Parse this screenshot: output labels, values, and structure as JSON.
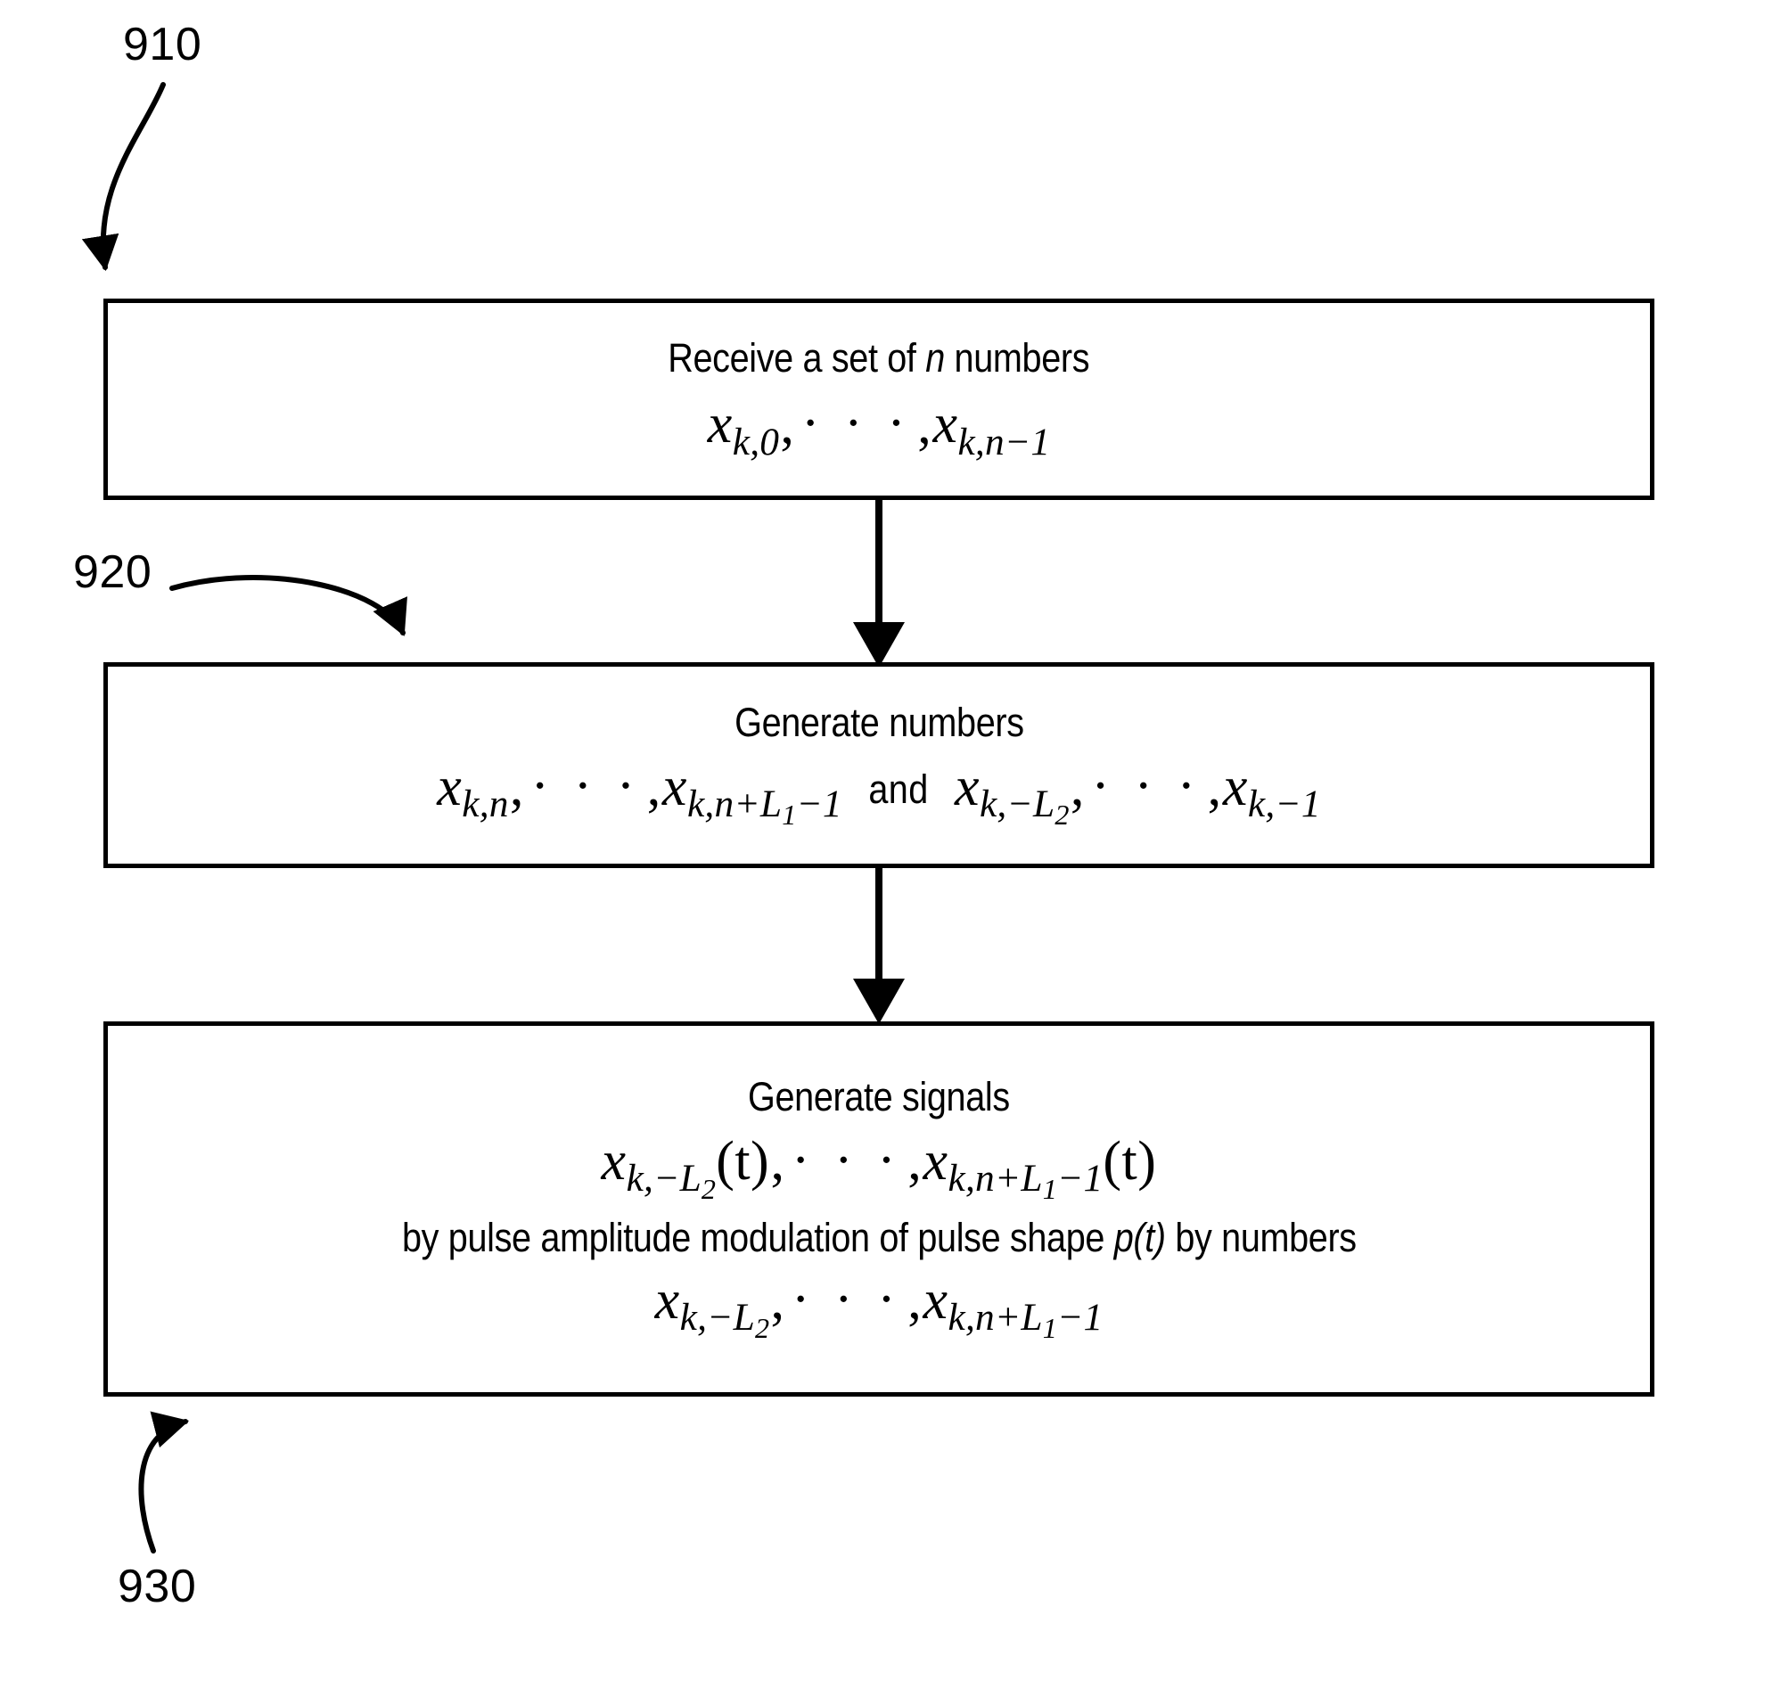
{
  "figure": {
    "type": "patent-flowchart",
    "orientation": "vertical-top-to-bottom",
    "background_color": "#ffffff",
    "line_color": "#000000",
    "step_count": 3
  },
  "reference_numerals": {
    "first": "910",
    "second": "920",
    "third": "930"
  },
  "steps": [
    {
      "numeral": "910",
      "title": "Receive a set of n numbers",
      "title_plain": "Receive a set of ",
      "title_italic_var": "n",
      "title_tail": " numbers",
      "formula_text": "x_{k,0}, ..., x_{k,n-1}",
      "math": {
        "var": "x",
        "sub_first": "k,0",
        "ellipsis": "· · ·",
        "sub_last": "k,n−1"
      }
    },
    {
      "numeral": "920",
      "title": "Generate numbers",
      "formula_text": "x_{k,n}, ..., x_{k,n+L1-1}  and  x_{k,-L2}, ..., x_{k,-1}",
      "conjunction": "and",
      "math": {
        "var": "x",
        "group_a_first_sub": "k,n",
        "group_a_last_sub": "k,n+L1−1",
        "group_b_first_sub": "k,−L2",
        "group_b_last_sub": "k,−1",
        "ellipsis": "· · ·"
      }
    },
    {
      "numeral": "930",
      "title": "Generate signals",
      "formula_signals_text": "x_{k,-L2}(t), ..., x_{k,n+L1-1}(t)",
      "description_line": "by pulse amplitude modulation of pulse shape p(t) by numbers",
      "description_before": "by pulse amplitude modulation of pulse shape ",
      "description_italic_var": "p",
      "description_paren_open": "(",
      "description_italic_arg": "t",
      "description_paren_close": ")",
      "description_after": " by numbers",
      "formula_numbers_text": "x_{k,-L2}, ..., x_{k,n+L1-1}",
      "math": {
        "var": "x",
        "signal_first_sub": "k,−L2",
        "signal_last_sub": "k,n+L1−1",
        "time_arg": "(t)",
        "number_first_sub": "k,−L2",
        "number_last_sub": "k,n+L1−1",
        "ellipsis": "· · ·"
      }
    }
  ],
  "glyphs": {
    "x_var": "x",
    "k_index": "k",
    "n_index": "n",
    "L_symbol": "L",
    "t_symbol": "t",
    "p_symbol": "p",
    "comma": ",",
    "minus": "−",
    "plus": "+",
    "one": "1",
    "two": "2",
    "zero": "0",
    "ellipsis": "· · ·",
    "paren_open": "(",
    "paren_close": ")"
  },
  "connectors": [
    {
      "name": "arrow-910-to-920",
      "from": "910",
      "to": "920",
      "style": "solid-vertical-arrow"
    },
    {
      "name": "arrow-920-to-930",
      "from": "920",
      "to": "930",
      "style": "solid-vertical-arrow"
    }
  ],
  "leaders": [
    {
      "name": "leader-910",
      "label": "910",
      "target": "box-910-top-left-corner"
    },
    {
      "name": "leader-920",
      "label": "920",
      "target": "box-920-top-edge"
    },
    {
      "name": "leader-930",
      "label": "930",
      "target": "box-930-bottom-edge"
    }
  ]
}
